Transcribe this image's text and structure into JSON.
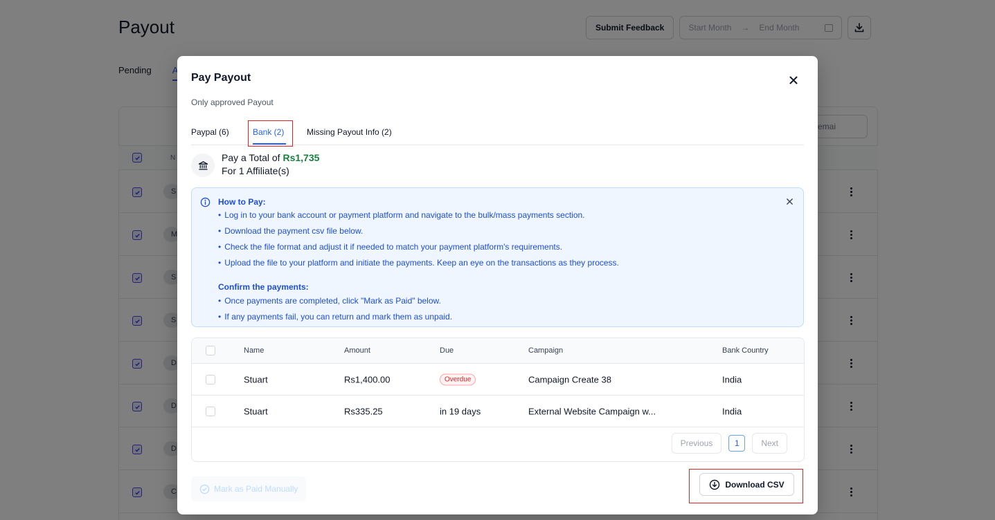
{
  "page": {
    "title": "Payout",
    "submit_feedback": "Submit Feedback",
    "start_month": "Start Month",
    "arrow": "→",
    "end_month": "End Month",
    "tabs": [
      "Pending",
      "A"
    ],
    "search_partial": "emai",
    "table_header_partial": "N",
    "row_initials": [
      "S",
      "M",
      "S",
      "S",
      "D",
      "D",
      "D",
      "C"
    ]
  },
  "modal": {
    "title": "Pay Payout",
    "subtitle": "Only approved Payout",
    "tabs": [
      {
        "label": "Paypal (6)"
      },
      {
        "label": "Bank (2)",
        "active": true
      },
      {
        "label": "Missing Payout Info (2)"
      }
    ],
    "summary": {
      "prefix": "Pay a Total of",
      "amount": "Rs1,735",
      "affiliates": "For 1 Affiliate(s)"
    },
    "info": {
      "heading": "How to Pay:",
      "steps": [
        "Log in to your bank account or payment platform and navigate to the bulk/mass payments section.",
        "Download the payment csv file below.",
        "Check the file format and adjust it if needed to match your payment platform's requirements.",
        "Upload the file to your platform and initiate the payments. Keep an eye on the transactions as they process."
      ],
      "heading2": "Confirm the payments:",
      "steps2": [
        "Once payments are completed, click \"Mark as Paid\" below.",
        "If any payments fail, you can return and mark them as unpaid."
      ]
    },
    "table": {
      "headers": [
        "Name",
        "Amount",
        "Due",
        "Campaign",
        "Bank Country"
      ],
      "rows": [
        {
          "name": "Stuart",
          "amount": "Rs1,400.00",
          "due": "Overdue",
          "campaign": "Campaign Create 38",
          "country": "India"
        },
        {
          "name": "Stuart",
          "amount": "Rs335.25",
          "due": "in 19 days",
          "campaign": "External Website Campaign w...",
          "country": "India"
        }
      ]
    },
    "pagination": {
      "previous": "Previous",
      "page": "1",
      "next": "Next"
    },
    "mark_paid": "Mark as Paid Manually",
    "download_csv": "Download CSV"
  },
  "colors": {
    "accent": "#2563eb",
    "amount": "#15803d",
    "overdue": "#dc2626",
    "highlight": "#dc2626"
  }
}
